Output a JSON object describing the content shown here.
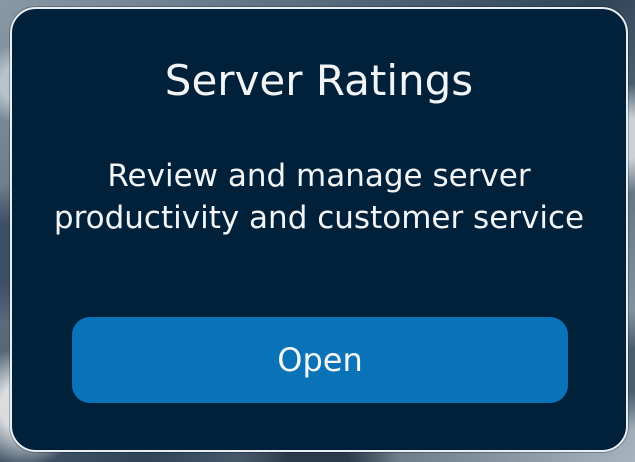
{
  "card": {
    "title": "Server Ratings",
    "description": "Review and manage server productivity and customer service",
    "open_label": "Open"
  },
  "colors": {
    "card_background": "#01213a",
    "button_background": "#0a73b8",
    "text": "#f2f5f8",
    "card_border": "#e9eef2"
  }
}
